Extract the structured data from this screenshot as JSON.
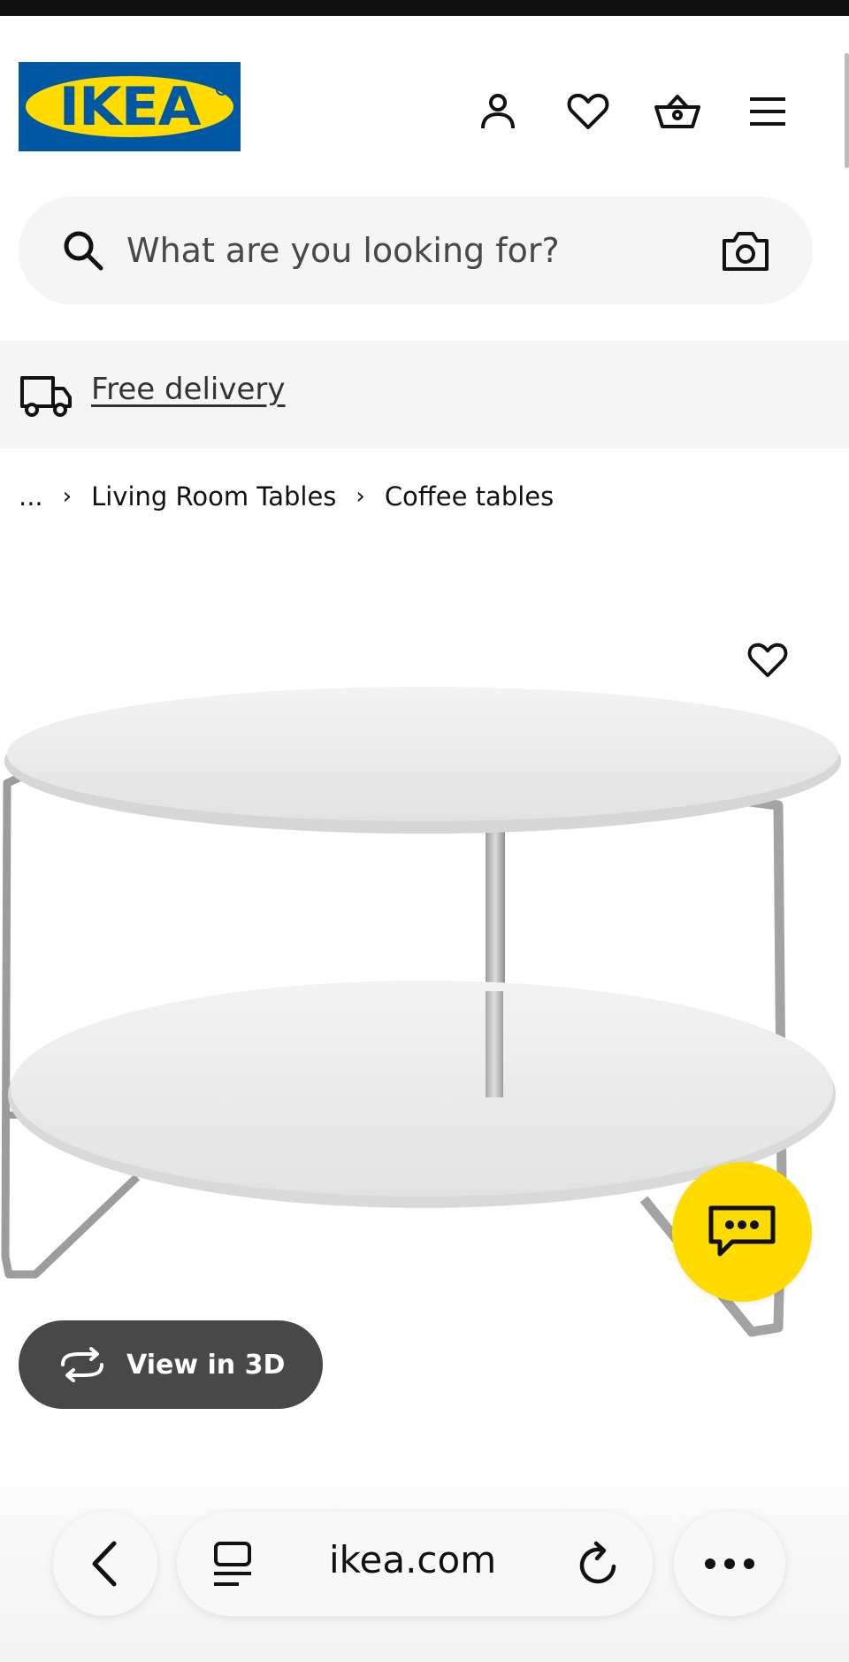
{
  "header": {
    "logo_text": "IKEA",
    "icons": [
      "account-icon",
      "favourites-icon",
      "basket-icon",
      "menu-icon"
    ],
    "brand_blue": "#0058a3",
    "brand_yellow": "#ffdb00"
  },
  "search": {
    "placeholder": "What are you looking for?",
    "icon": "search-icon",
    "visual_search_icon": "camera-icon"
  },
  "banner": {
    "icon": "delivery-truck-icon",
    "link": "Free delivery"
  },
  "breadcrumb": {
    "items": [
      "...",
      "Living Room Tables",
      "Coffee tables"
    ]
  },
  "product": {
    "image": "white round two-tier coffee table with chrome legs",
    "favourite_icon": "heart-icon",
    "view3d_label": "View in 3D",
    "chat_icon": "chat-icon"
  },
  "browser": {
    "url": "ikea.com",
    "icons": [
      "back-icon",
      "reader-mode-icon",
      "reload-icon",
      "more-icon"
    ]
  }
}
